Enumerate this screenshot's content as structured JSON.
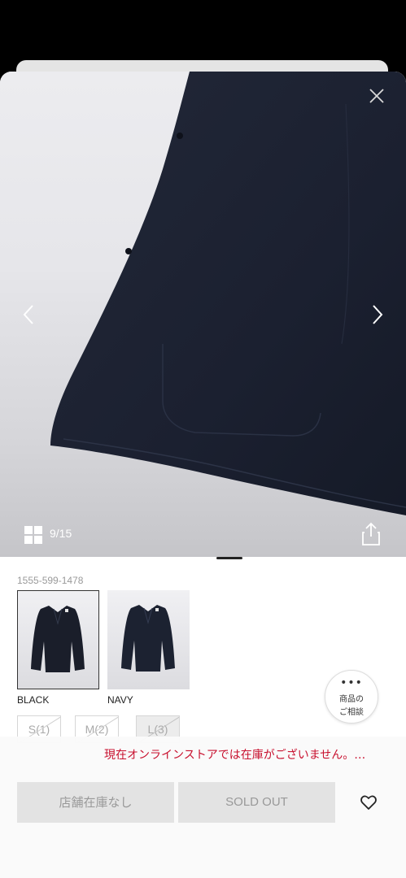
{
  "gallery": {
    "counter": "9/15"
  },
  "product": {
    "code": "1555-599-1478"
  },
  "colors": [
    {
      "label": "BLACK",
      "selected": true
    },
    {
      "label": "NAVY",
      "selected": false
    }
  ],
  "consult": {
    "dots": "•••",
    "line1": "商品の",
    "line2": "ご相談"
  },
  "sizes": [
    {
      "label": "S(1)",
      "available": false
    },
    {
      "label": "M(2)",
      "available": false
    },
    {
      "label": "L(3)",
      "available": false
    }
  ],
  "stock_notice": "現在オンラインストアでは在庫がございません。…",
  "actions": {
    "store_stock": "店舗在庫なし",
    "sold_out": "SOLD OUT"
  },
  "theme": {
    "alert_color": "#c8102e",
    "garment_color": "#1c2231"
  }
}
